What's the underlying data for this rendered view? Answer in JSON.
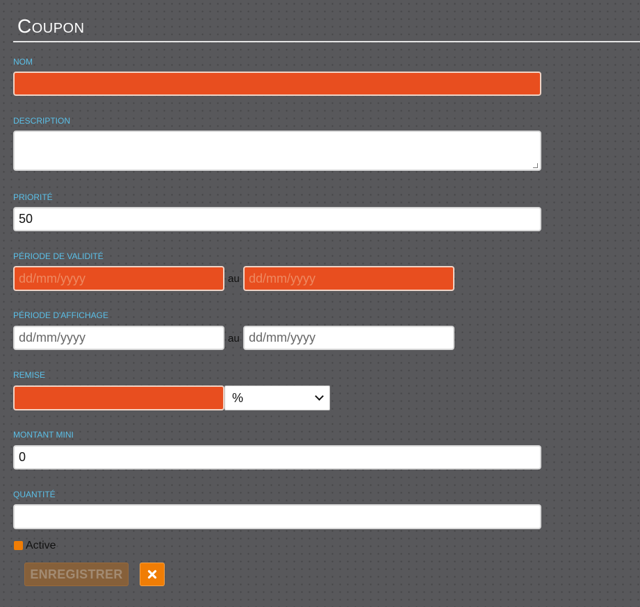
{
  "form": {
    "title": "Coupon",
    "nom": {
      "label": "NOM",
      "value": ""
    },
    "description": {
      "label": "DESCRIPTION",
      "value": ""
    },
    "priorite": {
      "label": "PRIORITÉ",
      "value": "50"
    },
    "periode_validite": {
      "label": "PÉRIODE DE VALIDITÉ",
      "from_placeholder": "dd/mm/yyyy",
      "separator": "au",
      "to_placeholder": "dd/mm/yyyy"
    },
    "periode_affichage": {
      "label": "PÉRIODE D'AFFICHAGE",
      "from_placeholder": "dd/mm/yyyy",
      "separator": "au",
      "to_placeholder": "dd/mm/yyyy"
    },
    "remise": {
      "label": "REMISE",
      "value": "",
      "unit_selected": "%"
    },
    "montant_mini": {
      "label": "MONTANT MINI",
      "value": "0"
    },
    "quantite": {
      "label": "QUANTITÉ",
      "value": ""
    },
    "active": {
      "label": "Active",
      "checked": true
    },
    "save_label": "ENREGISTRER",
    "cancel_icon": "close-icon"
  },
  "colors": {
    "background": "#58585b",
    "label": "#5bc0e8",
    "error_field": "#e84e1f",
    "accent": "#f07d05",
    "disabled_button": "#86603a"
  }
}
